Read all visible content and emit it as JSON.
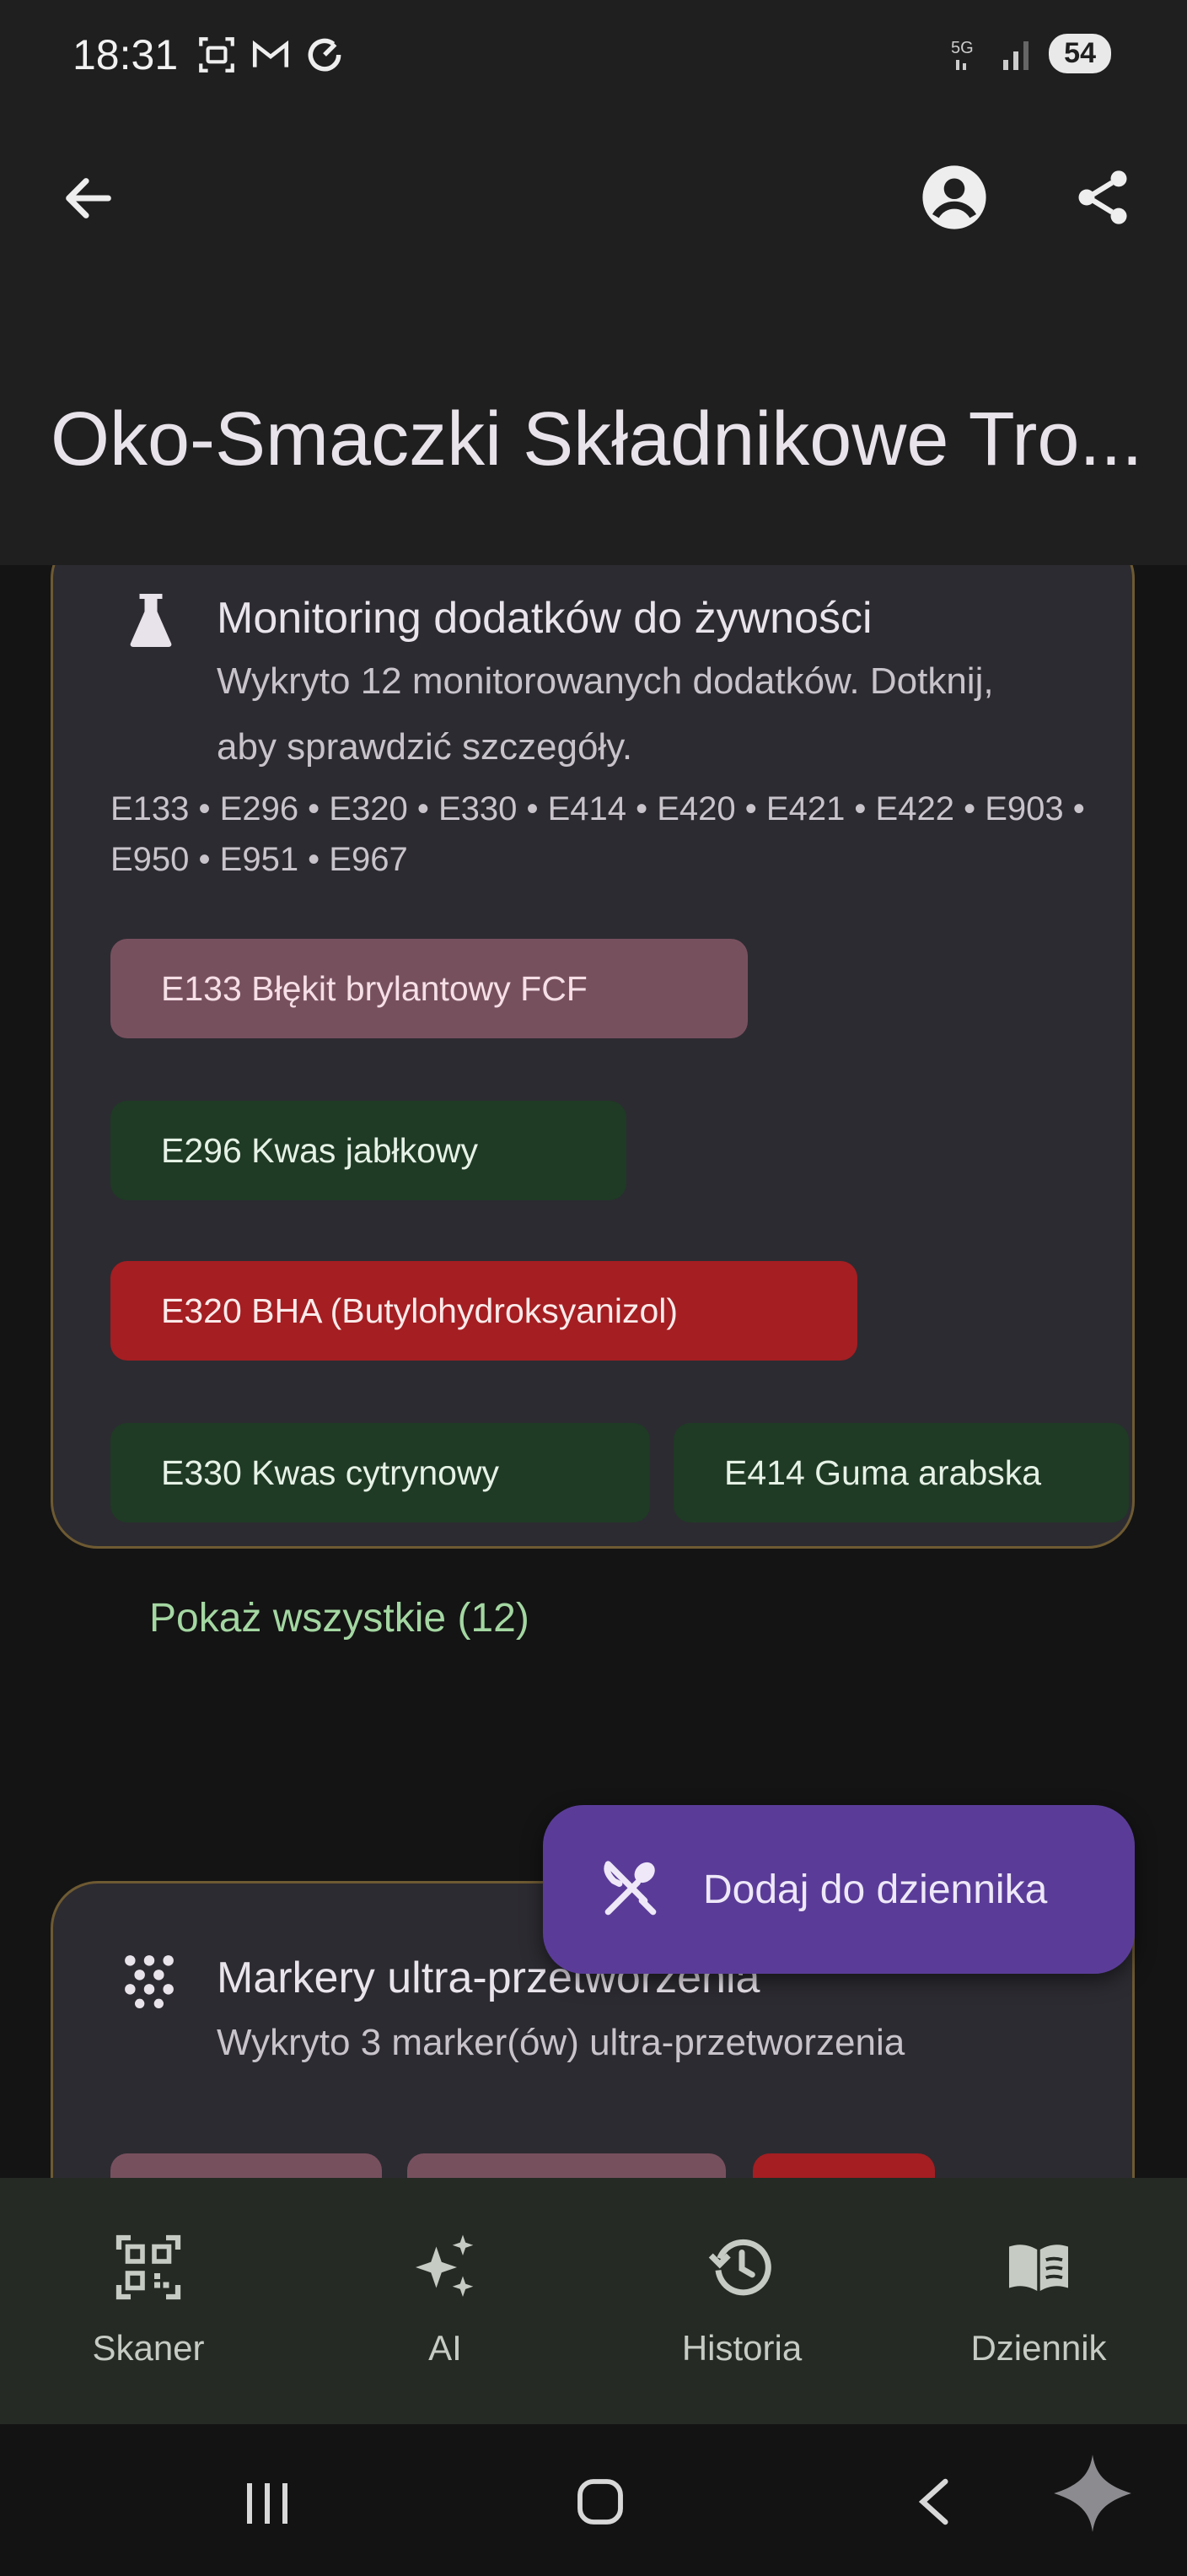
{
  "status_bar": {
    "time": "18:31",
    "battery": "54"
  },
  "header": {
    "title": "Oko-Smaczki Składnikowe Tro..."
  },
  "additives_card": {
    "title": "Monitoring dodatków do żywności",
    "subtitle": "Wykryto 12 monitorowanych dodatków. Dotknij, aby sprawdzić szczegóły.",
    "codes": "E133 • E296 • E320 • E330 • E414 • E420 • E421 • E422 • E903 • E950 • E951 • E967",
    "chips": [
      {
        "label": "E133 Błękit brylantowy FCF",
        "color": "#77505e"
      },
      {
        "label": "E296 Kwas jabłkowy",
        "color": "#1f3a25"
      },
      {
        "label": "E320 BHA (Butylohydroksyanizol)",
        "color": "#a41e22"
      },
      {
        "label": "E330 Kwas cytrynowy",
        "color": "#1f3a25"
      },
      {
        "label": "E414 Guma arabska",
        "color": "#1f3a25"
      }
    ],
    "show_all": "Pokaż wszystkie (12)"
  },
  "fab": {
    "label": "Dodaj do dziennika"
  },
  "ultra_card": {
    "title": "Markery ultra-przetworzenia",
    "subtitle": "Wykryto 3 marker(ów) ultra-przetworzenia"
  },
  "bottom_nav": {
    "items": [
      {
        "label": "Skaner",
        "icon": "qr-scanner-icon"
      },
      {
        "label": "AI",
        "icon": "sparkles-icon"
      },
      {
        "label": "Historia",
        "icon": "history-icon"
      },
      {
        "label": "Dziennik",
        "icon": "book-icon"
      }
    ]
  }
}
